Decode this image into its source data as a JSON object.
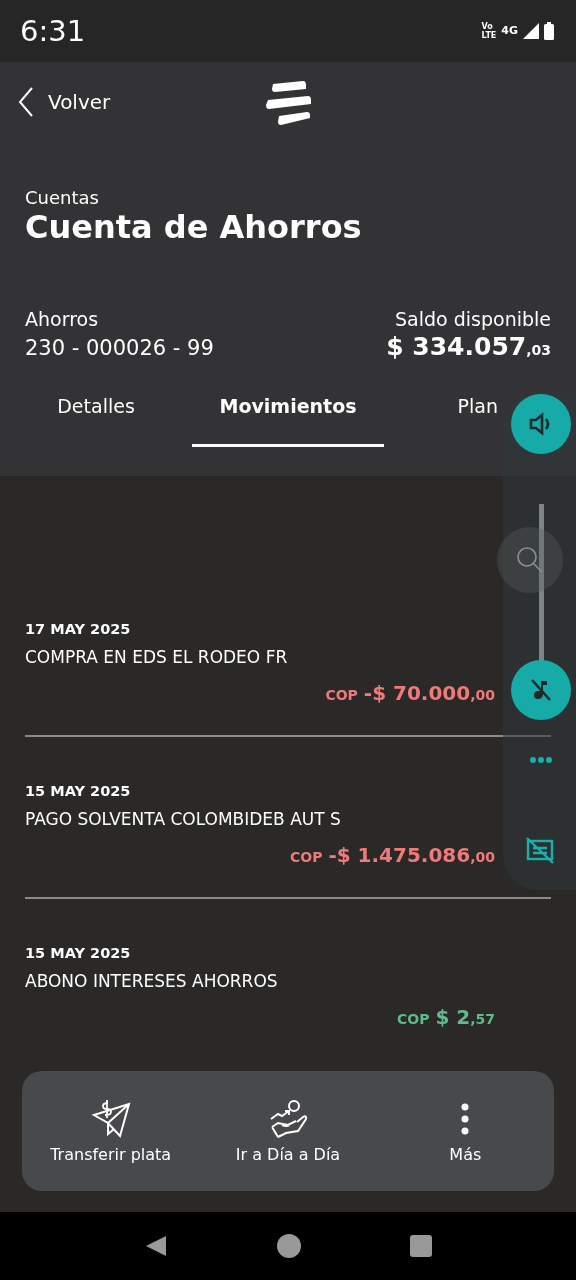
{
  "status_bar": {
    "time": "6:31",
    "network": "4G",
    "volte_top": "Vo",
    "volte_bottom": "LTE"
  },
  "header": {
    "back_label": "Volver"
  },
  "account": {
    "section": "Cuentas",
    "title": "Cuenta de Ahorros",
    "type": "Ahorros",
    "number": "230 - 000026 - 99",
    "balance_label": "Saldo disponible",
    "balance": "$ 334.057",
    "balance_cents": ",03"
  },
  "tabs": [
    {
      "label": "Detalles",
      "selected": false
    },
    {
      "label": "Movimientos",
      "selected": true
    },
    {
      "label": "Plan",
      "selected": false
    }
  ],
  "movements": [
    {
      "date": "17 MAY 2025",
      "description": "COMPRA EN EDS EL RODEO FR",
      "currency": "COP",
      "amount": "-$ 70.000",
      "cents": ",00",
      "kind": "debit"
    },
    {
      "date": "15 MAY 2025",
      "description": "PAGO SOLVENTA COLOMBIDEB AUT S",
      "currency": "COP",
      "amount": "-$ 1.475.086",
      "cents": ",00",
      "kind": "debit"
    },
    {
      "date": "15 MAY 2025",
      "description": "ABONO INTERESES AHORROS",
      "currency": "COP",
      "amount": "$ 2",
      "cents": ",57",
      "kind": "credit"
    }
  ],
  "volume_panel": {
    "level": 0
  },
  "actions": [
    {
      "label": "Transferir plata",
      "kind": "transfer"
    },
    {
      "label": "Ir a Día a Día",
      "kind": "savings"
    },
    {
      "label": "Más",
      "kind": "more"
    }
  ]
}
